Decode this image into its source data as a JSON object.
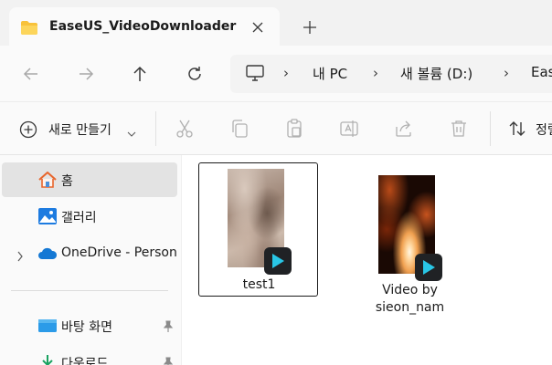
{
  "tab": {
    "title": "EaseUS_VideoDownloader"
  },
  "breadcrumb": {
    "items": [
      "내 PC",
      "새 볼륨 (D:)",
      "Eas"
    ]
  },
  "commandbar": {
    "new_label": "새로 만들기",
    "sort_label": "정렬"
  },
  "sidebar": {
    "items": [
      {
        "label": "홈"
      },
      {
        "label": "갤러리"
      },
      {
        "label": "OneDrive - Person"
      },
      {
        "label": "바탕 화면"
      },
      {
        "label": "다운로드"
      }
    ]
  },
  "files": [
    {
      "name": "test1"
    },
    {
      "name_line1": "Video by",
      "name_line2": "sieon_nam"
    }
  ],
  "colors": {
    "accent": "#0f6cbd",
    "play_badge_bg": "#202225",
    "play_icon": "#29c6e6"
  }
}
